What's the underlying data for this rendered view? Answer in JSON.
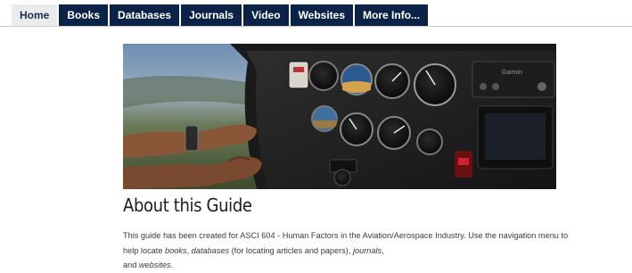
{
  "nav": {
    "tabs": [
      {
        "label": "Home",
        "active": true
      },
      {
        "label": "Books",
        "active": false
      },
      {
        "label": "Databases",
        "active": false
      },
      {
        "label": "Journals",
        "active": false
      },
      {
        "label": "Video",
        "active": false
      },
      {
        "label": "Websites",
        "active": false
      },
      {
        "label": "More Info...",
        "active": false
      }
    ]
  },
  "hero": {
    "panel_label": "Garmin"
  },
  "content": {
    "heading": "About this Guide",
    "description": {
      "part1": "This guide has been created for ASCI 604 - Human Factors in the Aviation/Aerospace Industry. Use the navigation menu to help locate ",
      "books": "books",
      "sep1": ", ",
      "databases": "databases",
      "part2": " (for locating articles and papers), ",
      "journals": "journals",
      "sep2": ",",
      "part3": " and ",
      "websites": "websites",
      "end": "."
    }
  },
  "colors": {
    "tab_bg": "#0c2348",
    "tab_active_bg": "#ebebeb"
  }
}
